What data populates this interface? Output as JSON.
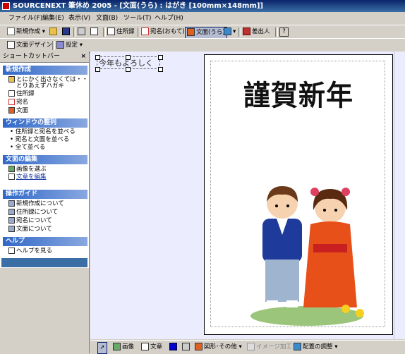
{
  "titlebar": {
    "title": "SOURCENEXT 筆休め 2005 - [文面(うら) : はがき [100mm×148mm]]"
  },
  "menu": [
    "ファイル(F)",
    "編集(E)",
    "表示(V)",
    "文面(B)",
    "ツール(T)",
    "ヘルプ(H)"
  ],
  "toolbar1": {
    "new_label": "新規作成",
    "address_book": "住所録",
    "front_label": "宛名(おもて)",
    "back_label": "文面(うら)",
    "sender_label": "差出人",
    "help_icon": "?"
  },
  "toolbar2": {
    "design_label": "文面デザイン",
    "settings_label": "設定"
  },
  "sidebar": {
    "title": "ショートカットバー",
    "close": "×",
    "sections": [
      {
        "title": "新規作成",
        "items": [
          "とにかく出さなくては・・・",
          "とりあえずハガキ",
          "住所録",
          "宛名",
          "文面"
        ]
      },
      {
        "title": "ウィンドウの整列",
        "items": [
          "住所録と宛名を並べる",
          "宛名と文面を並べる",
          "全て並べる"
        ]
      },
      {
        "title": "文面の編集",
        "items": [
          "画像を選ぶ",
          "文章を編集"
        ]
      },
      {
        "title": "操作ガイド",
        "items": [
          "新規作成について",
          "住所録について",
          "宛名について",
          "文面について"
        ]
      },
      {
        "title": "ヘルプ",
        "items": [
          "ヘルプを見る"
        ]
      }
    ]
  },
  "card": {
    "heading": "謹賀新年",
    "textbox": "今年もよろしく"
  },
  "bottom_toolbar": {
    "image": "画像",
    "text": "文章",
    "shapes": "図形･その他",
    "image_edit": "イメージ加工",
    "layout": "配置の調整"
  },
  "colors": {
    "titlebar": "#0a246a",
    "section": "#3068c8",
    "canvas": "#ececff"
  }
}
